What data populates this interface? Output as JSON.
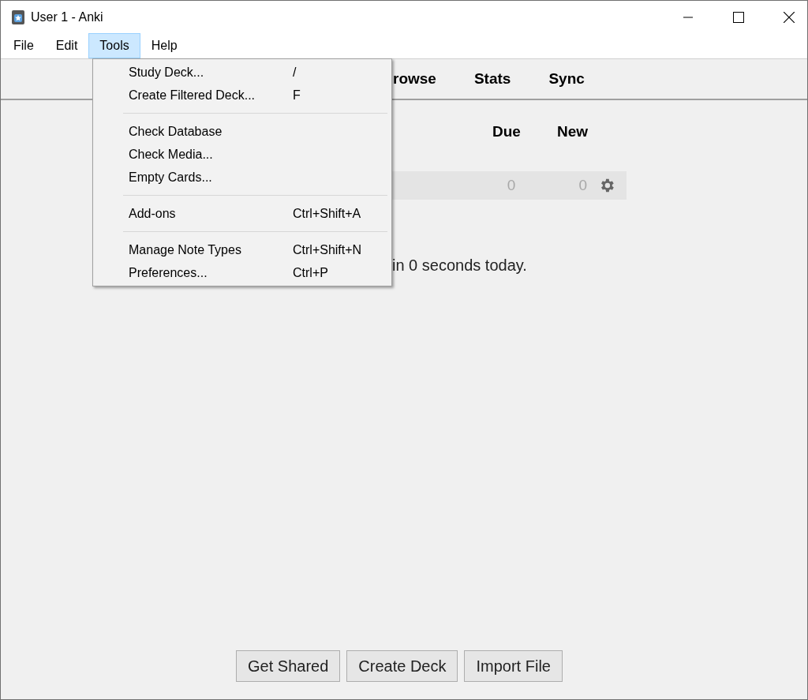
{
  "window": {
    "title": "User 1 - Anki"
  },
  "menu_bar": [
    {
      "label": "File",
      "selected": false
    },
    {
      "label": "Edit",
      "selected": false
    },
    {
      "label": "Tools",
      "selected": true
    },
    {
      "label": "Help",
      "selected": false
    }
  ],
  "tools_menu": [
    [
      {
        "label": "Study Deck...",
        "shortcut": "/"
      },
      {
        "label": "Create Filtered Deck...",
        "shortcut": "F"
      }
    ],
    [
      {
        "label": "Check Database"
      },
      {
        "label": "Check Media..."
      },
      {
        "label": "Empty Cards..."
      }
    ],
    [
      {
        "label": "Add-ons",
        "shortcut": "Ctrl+Shift+A"
      }
    ],
    [
      {
        "label": "Manage Note Types",
        "shortcut": "Ctrl+Shift+N"
      },
      {
        "label": "Preferences...",
        "shortcut": "Ctrl+P"
      }
    ]
  ],
  "toolbar": [
    "rowse",
    "Stats",
    "Sync"
  ],
  "deck_table": {
    "columns": [
      "Due",
      "New"
    ],
    "rows": [
      {
        "due": "0",
        "new": "0"
      }
    ]
  },
  "studied_text": "in 0 seconds today.",
  "buttons": [
    "Get Shared",
    "Create Deck",
    "Import File"
  ]
}
